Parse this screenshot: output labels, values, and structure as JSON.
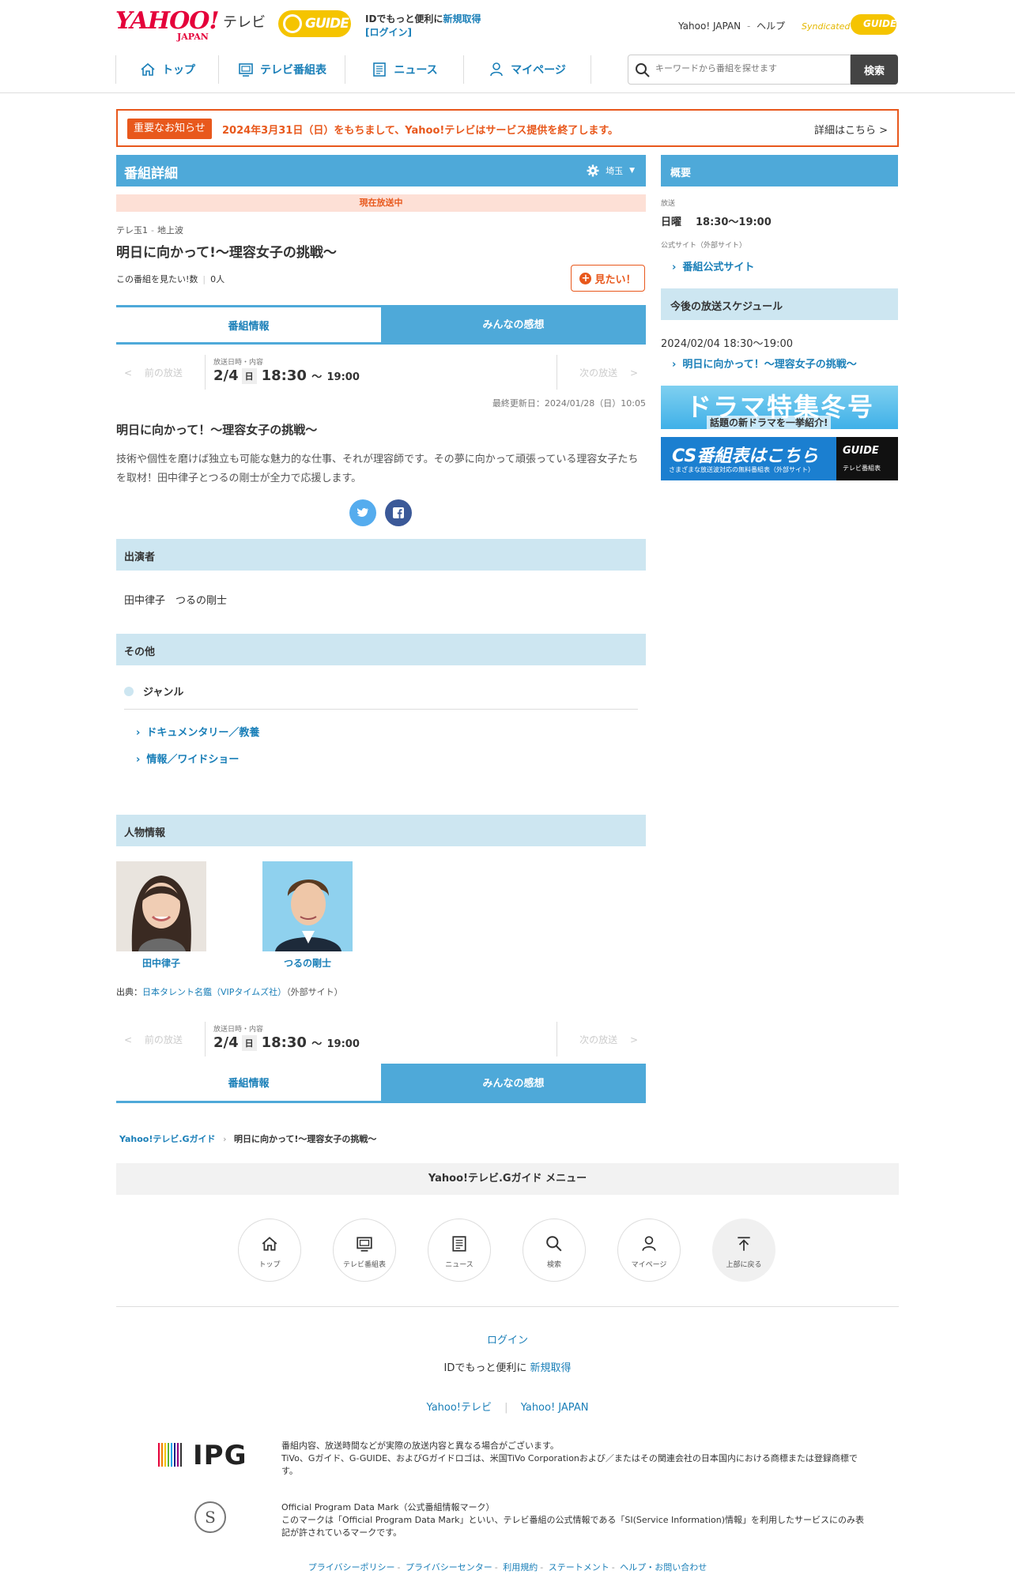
{
  "header": {
    "yahoo_logo": "YAHOO!",
    "yahoo_japan": "JAPAN",
    "tv_word": "テレビ",
    "gguide_logo": "GUIDE",
    "id_prefix": "IDでもっと便利に",
    "id_signup": "新規取得",
    "login": "[ログイン]",
    "yahoo_japan_link": "Yahoo! JAPAN",
    "help_link": "ヘルプ",
    "syndicated": "Syndicated",
    "syndicated_logo": "GUIDE",
    "nav": [
      {
        "label": "トップ",
        "icon": "home-icon"
      },
      {
        "label": "テレビ番組表",
        "icon": "tv-icon"
      },
      {
        "label": "ニュース",
        "icon": "news-icon"
      },
      {
        "label": "マイページ",
        "icon": "user-icon"
      }
    ],
    "search_placeholder": "キーワードから番組を探せます",
    "search_button": "検索"
  },
  "notice": {
    "tag": "重要なお知らせ",
    "message": "2024年3月31日（日）をもちまして、Yahoo!テレビはサービス提供を終了します。",
    "more": "詳細はこちら >"
  },
  "main": {
    "header_title": "番組詳細",
    "region": "埼玉",
    "on_air_badge": "現在放送中",
    "channel": "テレ玉1",
    "broadcast_type": "地上波",
    "title": "明日に向かって!〜理容女子の挑戦〜",
    "want_count_label": "この番組を見たい!数",
    "want_count": "0人",
    "want_button": "見たい！",
    "tabs": {
      "info": "番組情報",
      "impressions": "みんなの感想"
    },
    "broadcast_nav": {
      "prev": "前の放送",
      "next": "次の放送",
      "label": "放送日時・内容",
      "date": "2/4",
      "weekday": "日",
      "start": "18:30",
      "tilde": "〜",
      "end": "19:00"
    },
    "last_updated": "最終更新日：2024/01/28（日）10:05",
    "subtitle": "明日に向かって！〜理容女子の挑戦〜",
    "description": "技術や個性を磨けば独立も可能な魅力的な仕事、それが理容師です。その夢に向かって頑張っている理容女子たちを取材！田中律子とつるの剛士が全力で応援します。",
    "cast_header": "出演者",
    "cast": "田中律子　つるの剛士",
    "other_header": "その他",
    "genre_label": "ジャンル",
    "genres": [
      "ドキュメンタリー／教養",
      "情報／ワイドショー"
    ],
    "people_header": "人物情報",
    "people": [
      {
        "name": "田中律子"
      },
      {
        "name": "つるの剛士"
      }
    ],
    "source_prefix": "出典：",
    "source_link": "日本タレント名鑑（VIPタイムズ社）",
    "source_suffix": "（外部サイト）"
  },
  "breadcrumb": {
    "home": "Yahoo!テレビ.Gガイド",
    "current": "明日に向かって!〜理容女子の挑戦〜"
  },
  "sidebar": {
    "overview_title": "概要",
    "broadcast_label": "放送",
    "weekday": "日曜",
    "time": "18:30〜19:00",
    "official_label": "公式サイト（外部サイト）",
    "official_link": "番組公式サイト",
    "schedule_title": "今後の放送スケジュール",
    "schedule_datetime": "2024/02/04 18:30〜19:00",
    "schedule_link": "明日に向かって！〜理容女子の挑戦〜",
    "banner_drama_big": "ドラマ特集冬号",
    "banner_drama_small": "話題の新ドラマを一挙紹介!",
    "banner_cs_big": "CS番組表はこちら",
    "banner_cs_small": "さまざまな放送波対応の無料番組表（外部サイト）",
    "banner_cs_logo": "GUIDE",
    "banner_cs_logo_sub": "テレビ番組表"
  },
  "footer": {
    "menu_title": "Yahoo!テレビ.Gガイド メニュー",
    "buttons": [
      {
        "label": "トップ",
        "icon": "home-icon"
      },
      {
        "label": "テレビ番組表",
        "icon": "tv-icon"
      },
      {
        "label": "ニュース",
        "icon": "news-icon"
      },
      {
        "label": "検索",
        "icon": "search-icon"
      },
      {
        "label": "マイページ",
        "icon": "user-icon"
      },
      {
        "label": "上部に戻る",
        "icon": "arrow-up-icon"
      }
    ],
    "login": "ログイン",
    "id_prefix": "IDでもっと便利に",
    "id_signup": "新規取得",
    "yahoo_tv": "Yahoo!テレビ",
    "yahoo_japan": "Yahoo! JAPAN",
    "ipg_logo": "IPG",
    "disclaimer_1": "番組内容、放送時間などが実際の放送内容と異なる場合がございます。",
    "disclaimer_2": "TiVo、Gガイド、G-GUIDE、およびGガイドロゴは、米国TiVo Corporationおよび／またはその関連会社の日本国内における商標または登録商標です。",
    "seal_letter": "S",
    "mark_title": "Official Program Data Mark（公式番組情報マーク）",
    "mark_desc": "このマークは「Official Program Data Mark」といい、テレビ番組の公式情報である「SI(Service Information)情報」を利用したサービスにのみ表記が許されているマークです。",
    "links": [
      "プライバシーポリシー",
      "プライバシーセンター",
      "利用規約",
      "ステートメント",
      "ヘルプ・お問い合わせ"
    ]
  }
}
